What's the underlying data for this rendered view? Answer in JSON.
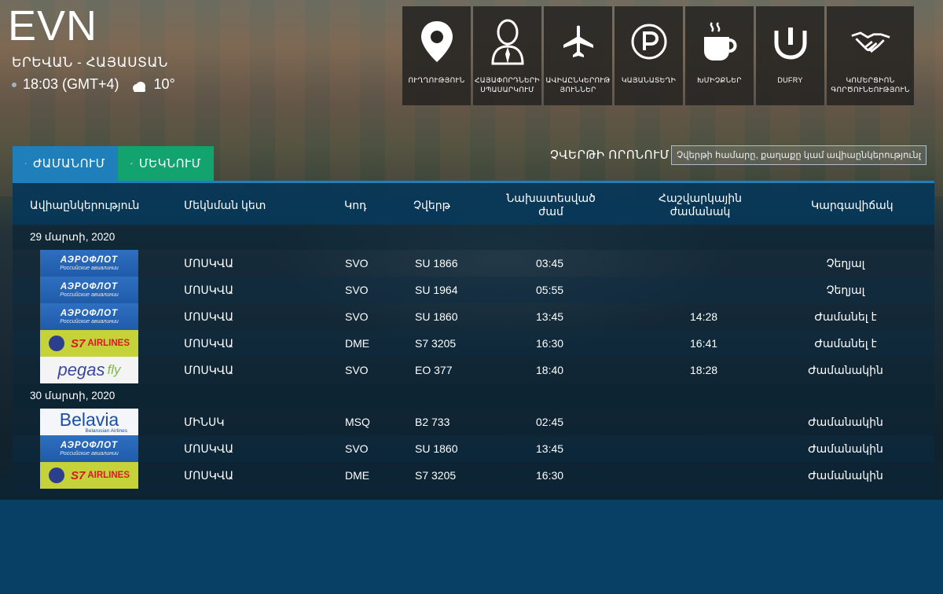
{
  "header": {
    "code": "EVN",
    "city": "ԵՐԵՎԱՆ - ՀԱՅԱՍՏԱՆ",
    "time": "18:03 (GMT+4)",
    "temperature": "10°",
    "weather_icon": "partly-cloudy-icon"
  },
  "nav": [
    {
      "label": "ՈՒՂՂՈՒԹՅՈՒՆ",
      "icon": "location-pin-icon"
    },
    {
      "label": "ՀԱՅԱՓՈՐԴՆԵՐԻ ՍՊԱՍԱՐԿՈՒՄ",
      "icon": "passenger-icon"
    },
    {
      "label": "ԱՎԻԱԸՆԿԵՐՈՒԹ ՅՈՒՆՆԵՐ",
      "icon": "airplane-icon"
    },
    {
      "label": "ԿԱՅԱՆԱՏԵՂԻ",
      "icon": "parking-icon"
    },
    {
      "label": "ԽՄԻՉՔՆԵՐ",
      "icon": "coffee-cup-icon"
    },
    {
      "label": "DUFRY",
      "icon": "dufry-logo-icon"
    },
    {
      "label": "ԿՈՄԵՐՑԻՈՆ ԳՈՐԾՈՒՆԵՈՒԹՅՈՒՆ",
      "icon": "handshake-icon"
    }
  ],
  "tabs": {
    "arrivals": "ԺԱՄԱՆՈՒՄ",
    "departures": "ՄԵԿՆՈՒՄ"
  },
  "search": {
    "label": "ՉՎԵՐԹԻ ՈՐՈՆՈՒՄ",
    "placeholder": "Չվերթի համարը, քաղաքը կամ ավիաընկերությունը"
  },
  "columns": {
    "airline": "Ավիաընկերություն",
    "origin": "Մեկնման կետ",
    "code": "Կոդ",
    "flight": "Չվերթ",
    "scheduled_line1": "Նախատեսված",
    "scheduled_line2": "ժամ",
    "estimated_line1": "Հաշվարկային",
    "estimated_line2": "ժամանակ",
    "status": "Կարգավիճակ"
  },
  "days": [
    {
      "date": "29 մարտի, 2020",
      "flights": [
        {
          "airline": "aeroflot",
          "origin": "ՄՈՍԿՎԱ",
          "code": "SVO",
          "flight": "SU 1866",
          "scheduled": "03:45",
          "estimated": "",
          "status": "Չեղյալ"
        },
        {
          "airline": "aeroflot",
          "origin": "ՄՈՍԿՎԱ",
          "code": "SVO",
          "flight": "SU 1964",
          "scheduled": "05:55",
          "estimated": "",
          "status": "Չեղյալ"
        },
        {
          "airline": "aeroflot",
          "origin": "ՄՈՍԿՎԱ",
          "code": "SVO",
          "flight": "SU 1860",
          "scheduled": "13:45",
          "estimated": "14:28",
          "status": "Ժամանել է"
        },
        {
          "airline": "s7",
          "origin": "ՄՈՍԿՎԱ",
          "code": "DME",
          "flight": "S7 3205",
          "scheduled": "16:30",
          "estimated": "16:41",
          "status": "Ժամանել է"
        },
        {
          "airline": "pegas",
          "origin": "ՄՈՍԿՎԱ",
          "code": "SVO",
          "flight": "EO 377",
          "scheduled": "18:40",
          "estimated": "18:28",
          "status": "Ժամանակին"
        }
      ]
    },
    {
      "date": "30 մարտի, 2020",
      "flights": [
        {
          "airline": "belavia",
          "origin": "ՄԻՆՍԿ",
          "code": "MSQ",
          "flight": "B2 733",
          "scheduled": "02:45",
          "estimated": "",
          "status": "Ժամանակին"
        },
        {
          "airline": "aeroflot",
          "origin": "ՄՈՍԿՎԱ",
          "code": "SVO",
          "flight": "SU 1860",
          "scheduled": "13:45",
          "estimated": "",
          "status": "Ժամանակին"
        },
        {
          "airline": "s7",
          "origin": "ՄՈՍԿՎԱ",
          "code": "DME",
          "flight": "S7 3205",
          "scheduled": "16:30",
          "estimated": "",
          "status": "Ժամանակին"
        }
      ]
    }
  ],
  "logos": {
    "aeroflot": {
      "line1": "АЭРОФЛОТ",
      "line2": "Российские авиалинии"
    },
    "s7": {
      "mark": "S7",
      "text": "AIRLINES"
    },
    "pegas": {
      "part1": "pegas",
      "part2": "fly"
    },
    "belavia": {
      "line1": "Belavia",
      "line2": "Belarusian Airlines"
    }
  },
  "colors": {
    "arrivals_tab": "#1f7fba",
    "departures_tab": "#12a36e",
    "tile_bg": "#262422"
  }
}
